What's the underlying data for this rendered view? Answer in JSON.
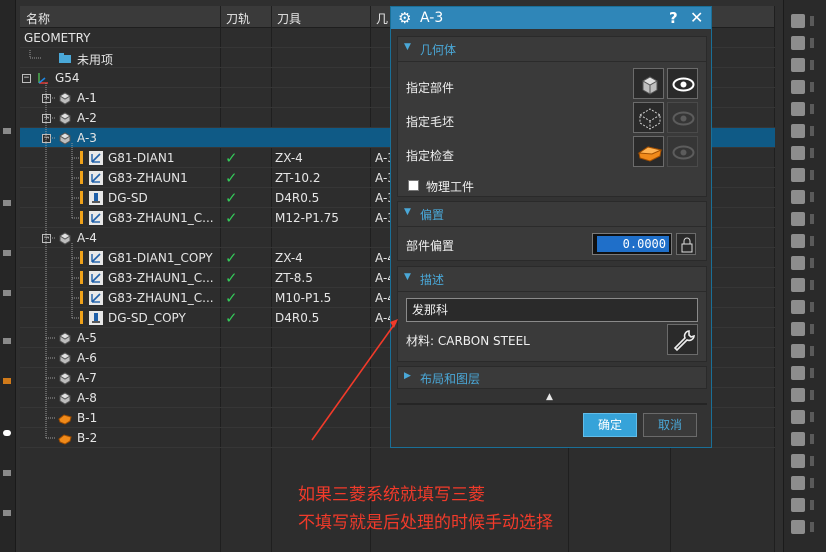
{
  "navigator": {
    "columns": [
      "名称",
      "刀轨",
      "刀具",
      "几"
    ],
    "rows": [
      {
        "name": "GEOMETRY",
        "path": "",
        "tool": "",
        "geom": "",
        "level": 0,
        "icon": "none",
        "expander": "",
        "warn": false,
        "selected": false
      },
      {
        "name": "未用项",
        "path": "",
        "tool": "",
        "geom": "",
        "level": 1,
        "icon": "folder-icon",
        "expander": "",
        "warn": false,
        "selected": false
      },
      {
        "name": "G54",
        "path": "",
        "tool": "",
        "geom": "",
        "level": 0,
        "icon": "mcs-icon",
        "expander": "−",
        "warn": false,
        "selected": false
      },
      {
        "name": "A-1",
        "path": "",
        "tool": "",
        "geom": "",
        "level": 1,
        "icon": "workpiece-icon",
        "expander": "+",
        "warn": false,
        "selected": false
      },
      {
        "name": "A-2",
        "path": "",
        "tool": "",
        "geom": "",
        "level": 1,
        "icon": "workpiece-icon",
        "expander": "+",
        "warn": false,
        "selected": false
      },
      {
        "name": "A-3",
        "path": "",
        "tool": "",
        "geom": "",
        "level": 1,
        "icon": "workpiece-icon",
        "expander": "−",
        "warn": false,
        "selected": true
      },
      {
        "name": "G81-DIAN1",
        "path": "✓",
        "tool": "ZX-4",
        "geom": "A-3",
        "level": 2,
        "icon": "drill-op-icon",
        "expander": "",
        "warn": true,
        "selected": false
      },
      {
        "name": "G83-ZHAUN1",
        "path": "✓",
        "tool": "ZT-10.2",
        "geom": "A-3",
        "level": 2,
        "icon": "drill-op-icon",
        "expander": "",
        "warn": true,
        "selected": false
      },
      {
        "name": "DG-SD",
        "path": "✓",
        "tool": "D4R0.5",
        "geom": "A-3",
        "level": 2,
        "icon": "mill-op-icon",
        "expander": "",
        "warn": true,
        "selected": false
      },
      {
        "name": "G83-ZHAUN1_C...",
        "path": "✓",
        "tool": "M12-P1.75",
        "geom": "A-3",
        "level": 2,
        "icon": "drill-op-icon",
        "expander": "",
        "warn": true,
        "selected": false
      },
      {
        "name": "A-4",
        "path": "",
        "tool": "",
        "geom": "",
        "level": 1,
        "icon": "workpiece-icon",
        "expander": "−",
        "warn": false,
        "selected": false
      },
      {
        "name": "G81-DIAN1_COPY",
        "path": "✓",
        "tool": "ZX-4",
        "geom": "A-4",
        "level": 2,
        "icon": "drill-op-icon",
        "expander": "",
        "warn": true,
        "selected": false
      },
      {
        "name": "G83-ZHAUN1_C...",
        "path": "✓",
        "tool": "ZT-8.5",
        "geom": "A-4",
        "level": 2,
        "icon": "drill-op-icon",
        "expander": "",
        "warn": true,
        "selected": false
      },
      {
        "name": "G83-ZHAUN1_C...",
        "path": "✓",
        "tool": "M10-P1.5",
        "geom": "A-4",
        "level": 2,
        "icon": "drill-op-icon",
        "expander": "",
        "warn": true,
        "selected": false
      },
      {
        "name": "DG-SD_COPY",
        "path": "✓",
        "tool": "D4R0.5",
        "geom": "A-4",
        "level": 2,
        "icon": "mill-op-icon",
        "expander": "",
        "warn": true,
        "selected": false
      },
      {
        "name": "A-5",
        "path": "",
        "tool": "",
        "geom": "",
        "level": 1,
        "icon": "workpiece-icon",
        "expander": "",
        "warn": false,
        "selected": false
      },
      {
        "name": "A-6",
        "path": "",
        "tool": "",
        "geom": "",
        "level": 1,
        "icon": "workpiece-icon",
        "expander": "",
        "warn": false,
        "selected": false
      },
      {
        "name": "A-7",
        "path": "",
        "tool": "",
        "geom": "",
        "level": 1,
        "icon": "workpiece-icon",
        "expander": "",
        "warn": false,
        "selected": false
      },
      {
        "name": "A-8",
        "path": "",
        "tool": "",
        "geom": "",
        "level": 1,
        "icon": "workpiece-icon",
        "expander": "",
        "warn": false,
        "selected": false
      },
      {
        "name": "B-1",
        "path": "",
        "tool": "",
        "geom": "",
        "level": 1,
        "icon": "part-orange-icon",
        "expander": "",
        "warn": false,
        "selected": false
      },
      {
        "name": "B-2",
        "path": "",
        "tool": "",
        "geom": "",
        "level": 1,
        "icon": "part-orange-icon",
        "expander": "",
        "warn": false,
        "selected": false
      }
    ]
  },
  "dialog": {
    "title": "A-3",
    "help": "?",
    "close": "✕",
    "geometry": {
      "header": "几何体",
      "specify_part": "指定部件",
      "specify_blank": "指定毛坯",
      "specify_check": "指定检查",
      "physical_workpiece": "物理工件"
    },
    "offset": {
      "header": "偏置",
      "part_offset": "部件偏置",
      "value": "0.0000"
    },
    "description": {
      "header": "描述",
      "text": "发那科",
      "material": "材料: CARBON STEEL"
    },
    "layout": {
      "header": "布局和图层"
    },
    "ok": "确定",
    "cancel": "取消"
  },
  "annotation": {
    "line1": "如果三菱系统就填写三菱",
    "line2": "不填写就是后处理的时候手动选择",
    "color": "#f23a2a"
  },
  "colors": {
    "accent": "#2f86b8",
    "selection": "#0f5a86",
    "check": "#34c759",
    "warning": "#f0a21a"
  }
}
